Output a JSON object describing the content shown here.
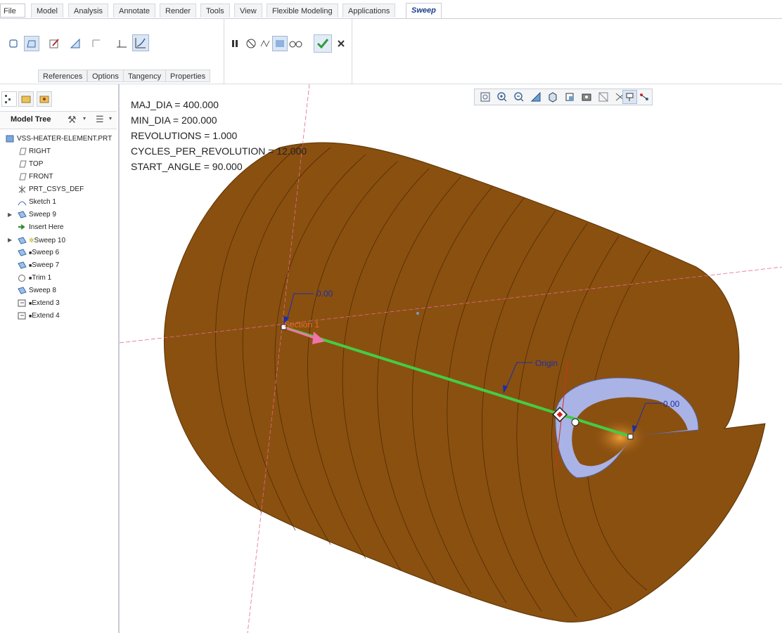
{
  "menubar": {
    "file": "File",
    "tabs": [
      "Model",
      "Analysis",
      "Annotate",
      "Render",
      "Tools",
      "View",
      "Flexible Modeling",
      "Applications"
    ],
    "active_tab": "Sweep"
  },
  "ribbon": {
    "subtabs": [
      "References",
      "Options",
      "Tangency",
      "Properties"
    ]
  },
  "model_tree": {
    "title": "Model Tree",
    "items": [
      "VSS-HEATER-ELEMENT.PRT",
      "RIGHT",
      "TOP",
      "FRONT",
      "PRT_CSYS_DEF",
      "Sketch 1",
      "Sweep 9",
      "Insert Here",
      "Sweep 10",
      "Sweep 6",
      "Sweep 7",
      "Trim 1",
      "Sweep 8",
      "Extend 3",
      "Extend 4"
    ]
  },
  "viewport": {
    "params": [
      "MAJ_DIA = 400.000",
      "MIN_DIA =  200.000",
      "REVOLUTIONS = 1.000",
      "CYCLES_PER_REVOLUTION = 12.000",
      "START_ANGLE = 90.000"
    ],
    "labels": {
      "dim1": "0.00",
      "section": "Section 1",
      "origin": "Origin",
      "dim2": "0.00"
    }
  },
  "colors": {
    "surface": "#8a5010",
    "trajectory": "#44cc44",
    "inner_surface": "#aab3e6",
    "datum_plane": "#e46a8e",
    "accept": "#2e9e3e"
  }
}
